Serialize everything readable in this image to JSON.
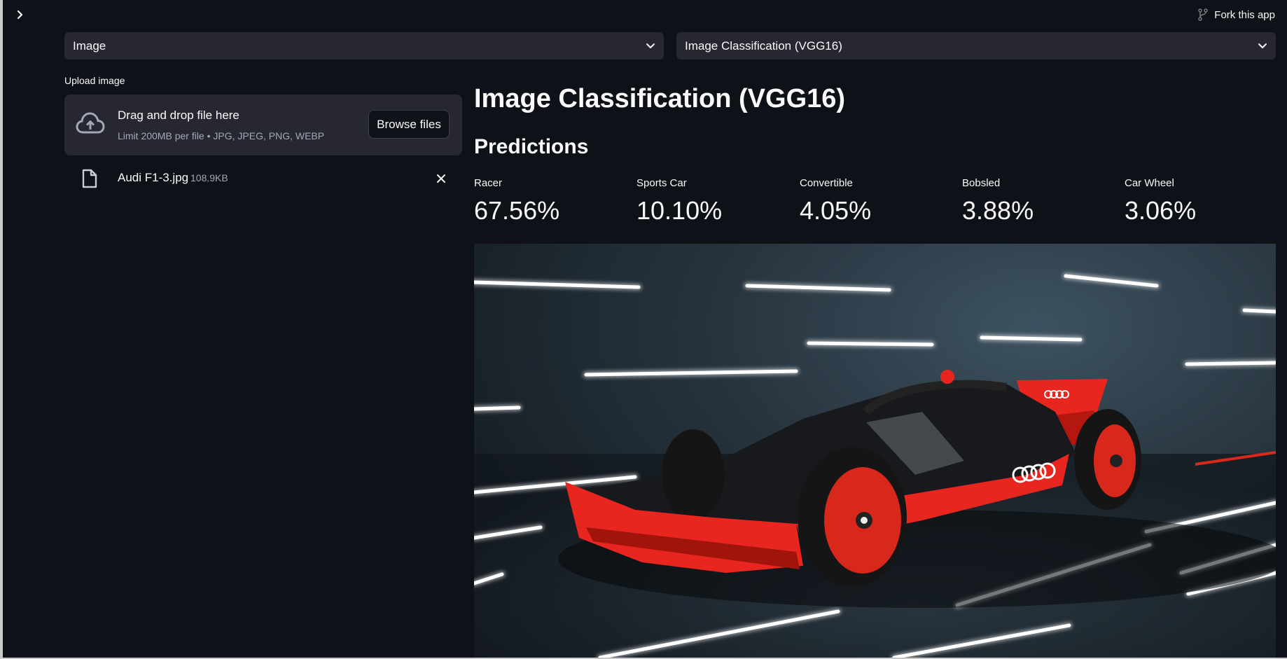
{
  "header": {
    "fork_label": "Fork this app",
    "sidebar_toggle_icon": "chevron-right-icon",
    "fork_icon": "github-fork-icon"
  },
  "selects": {
    "input_type": {
      "value": "Image"
    },
    "model": {
      "value": "Image Classification (VGG16)"
    }
  },
  "uploader": {
    "label": "Upload image",
    "drop_title": "Drag and drop file here",
    "drop_subtitle": "Limit 200MB per file • JPG, JPEG, PNG, WEBP",
    "browse_label": "Browse files",
    "file": {
      "name": "Audi F1-3.jpg",
      "size": "108.9KB"
    }
  },
  "main": {
    "title": "Image Classification (VGG16)",
    "subtitle": "Predictions",
    "predictions": [
      {
        "label": "Racer",
        "value": "67.56%"
      },
      {
        "label": "Sports Car",
        "value": "10.10%"
      },
      {
        "label": "Convertible",
        "value": "4.05%"
      },
      {
        "label": "Bobsled",
        "value": "3.88%"
      },
      {
        "label": "Car Wheel",
        "value": "3.06%"
      }
    ],
    "image": {
      "subject": "audi-f1-car-photo"
    }
  },
  "colors": {
    "background": "#0e1117",
    "widget": "#262730",
    "text": "#fafafa",
    "muted": "#a3a8b8",
    "accent_red": "#e8261f"
  }
}
